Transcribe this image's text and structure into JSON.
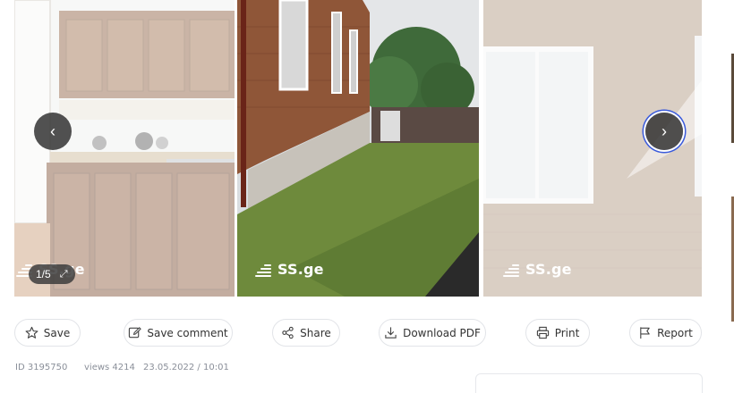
{
  "gallery": {
    "counter": "1/5",
    "watermark": "SS.ge",
    "prev_arrow": "‹",
    "next_arrow": "›",
    "fullscreen_icon": "⤢"
  },
  "actions": {
    "save": "Save",
    "save_comment": "Save comment",
    "share": "Share",
    "download_pdf": "Download PDF",
    "print": "Print",
    "report": "Report"
  },
  "meta": {
    "id": "ID 3195750",
    "views": "views 4214",
    "date": "23.05.2022 / 10:01"
  }
}
